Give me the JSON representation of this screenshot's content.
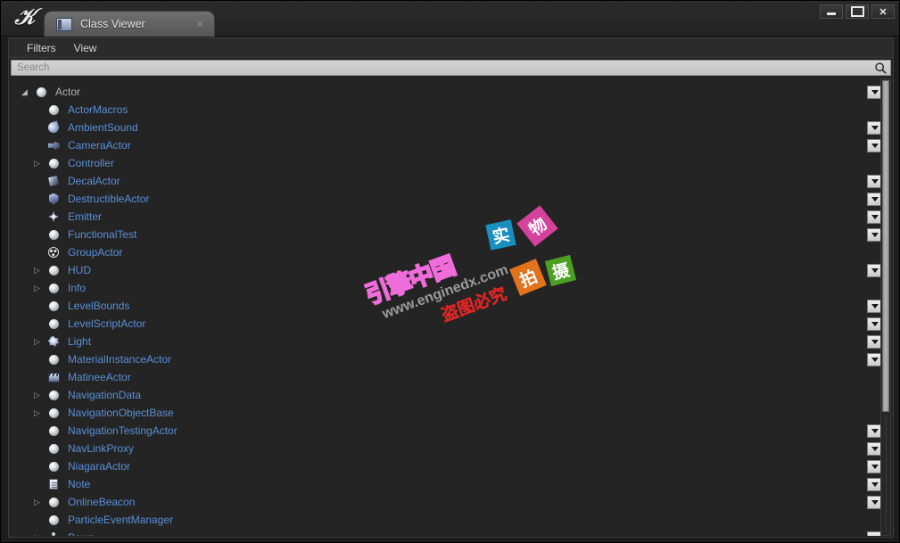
{
  "window": {
    "logo": "unreal-engine-logo",
    "tab_title": "Class Viewer",
    "tab_close": "×",
    "minimize": "minimize",
    "maximize": "maximize",
    "close": "close"
  },
  "menu": {
    "items": [
      {
        "label": "Filters"
      },
      {
        "label": "View"
      }
    ]
  },
  "search": {
    "value": "",
    "placeholder": "Search",
    "icon": "search-icon"
  },
  "tree": {
    "rows": [
      {
        "label": "Actor",
        "depth": 0,
        "twisty": "open",
        "icon": "sphere",
        "dropdown": true
      },
      {
        "label": "ActorMacros",
        "depth": 1,
        "twisty": "none",
        "icon": "sphere",
        "dropdown": false
      },
      {
        "label": "AmbientSound",
        "depth": 1,
        "twisty": "none",
        "icon": "sound",
        "dropdown": true
      },
      {
        "label": "CameraActor",
        "depth": 1,
        "twisty": "none",
        "icon": "camera",
        "dropdown": true
      },
      {
        "label": "Controller",
        "depth": 1,
        "twisty": "closed",
        "icon": "sphere",
        "dropdown": false
      },
      {
        "label": "DecalActor",
        "depth": 1,
        "twisty": "none",
        "icon": "decal",
        "dropdown": true
      },
      {
        "label": "DestructibleActor",
        "depth": 1,
        "twisty": "none",
        "icon": "destruct",
        "dropdown": true
      },
      {
        "label": "Emitter",
        "depth": 1,
        "twisty": "none",
        "icon": "emitter",
        "dropdown": true
      },
      {
        "label": "FunctionalTest",
        "depth": 1,
        "twisty": "none",
        "icon": "sphere",
        "dropdown": true
      },
      {
        "label": "GroupActor",
        "depth": 1,
        "twisty": "none",
        "icon": "group",
        "dropdown": false
      },
      {
        "label": "HUD",
        "depth": 1,
        "twisty": "closed",
        "icon": "sphere",
        "dropdown": true
      },
      {
        "label": "Info",
        "depth": 1,
        "twisty": "closed",
        "icon": "sphere",
        "dropdown": false
      },
      {
        "label": "LevelBounds",
        "depth": 1,
        "twisty": "none",
        "icon": "sphere",
        "dropdown": true
      },
      {
        "label": "LevelScriptActor",
        "depth": 1,
        "twisty": "none",
        "icon": "sphere",
        "dropdown": true
      },
      {
        "label": "Light",
        "depth": 1,
        "twisty": "closed",
        "icon": "light",
        "dropdown": true
      },
      {
        "label": "MaterialInstanceActor",
        "depth": 1,
        "twisty": "none",
        "icon": "sphere",
        "dropdown": true
      },
      {
        "label": "MatineeActor",
        "depth": 1,
        "twisty": "none",
        "icon": "matinee",
        "dropdown": false
      },
      {
        "label": "NavigationData",
        "depth": 1,
        "twisty": "closed",
        "icon": "sphere",
        "dropdown": false
      },
      {
        "label": "NavigationObjectBase",
        "depth": 1,
        "twisty": "closed",
        "icon": "sphere",
        "dropdown": false
      },
      {
        "label": "NavigationTestingActor",
        "depth": 1,
        "twisty": "none",
        "icon": "sphere",
        "dropdown": true
      },
      {
        "label": "NavLinkProxy",
        "depth": 1,
        "twisty": "none",
        "icon": "sphere",
        "dropdown": true
      },
      {
        "label": "NiagaraActor",
        "depth": 1,
        "twisty": "none",
        "icon": "sphere",
        "dropdown": true
      },
      {
        "label": "Note",
        "depth": 1,
        "twisty": "none",
        "icon": "note",
        "dropdown": true
      },
      {
        "label": "OnlineBeacon",
        "depth": 1,
        "twisty": "closed",
        "icon": "sphere",
        "dropdown": true
      },
      {
        "label": "ParticleEventManager",
        "depth": 1,
        "twisty": "none",
        "icon": "sphere",
        "dropdown": false
      },
      {
        "label": "Pawn",
        "depth": 1,
        "twisty": "closed",
        "icon": "pawn",
        "dropdown": true
      }
    ]
  },
  "colors": {
    "class_link": "#5a8fd6",
    "root_text": "#b0b0b0",
    "panel_bg": "#242424",
    "search_bg": "#cccccc"
  },
  "watermark": {
    "brand": "引擎中国",
    "url": "www.enginedx.com",
    "notice": "盗图必究",
    "boxes": [
      "实",
      "物",
      "拍",
      "摄"
    ]
  }
}
